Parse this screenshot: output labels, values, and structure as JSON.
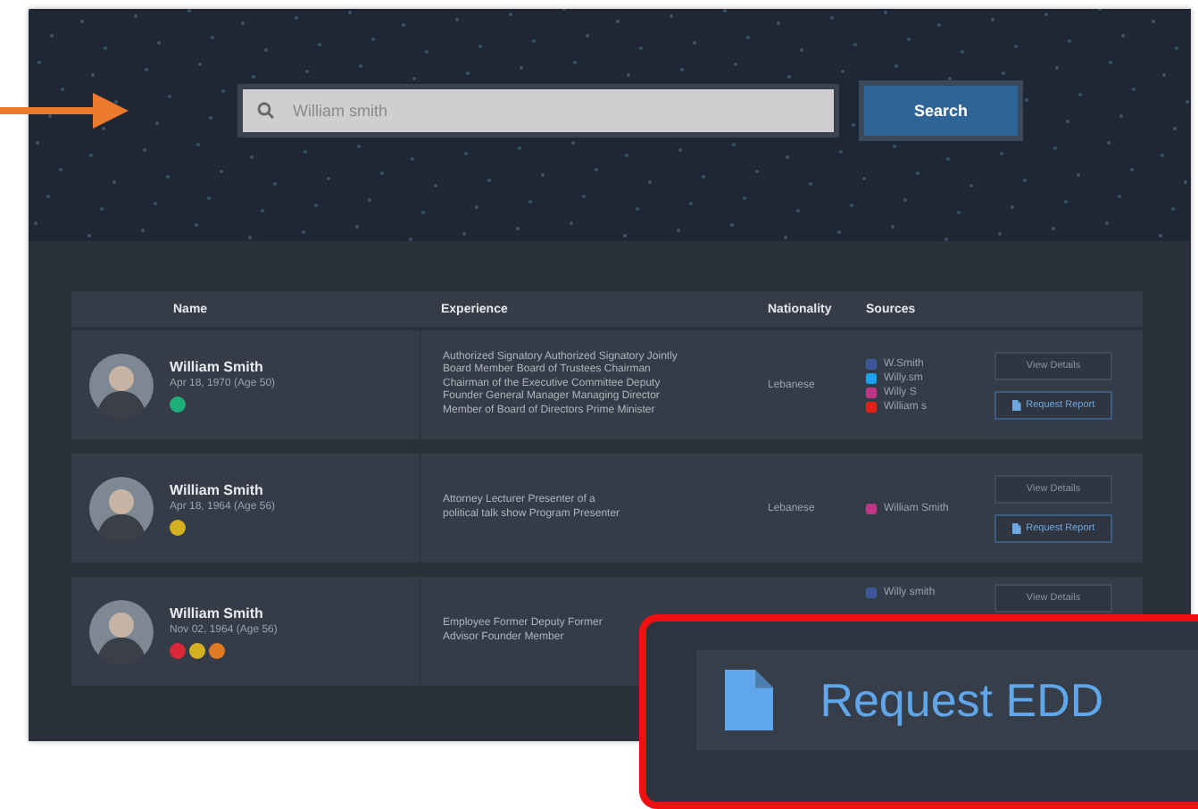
{
  "search": {
    "placeholder": "William smith",
    "button": "Search"
  },
  "table": {
    "columns": [
      "Name",
      "Experience",
      "Nationality",
      "Sources"
    ],
    "rows": [
      {
        "name": "William Smith",
        "born": "Apr 18, 1970 (Age 50)",
        "badges": [
          {
            "color": "#1fae7a"
          }
        ],
        "experience": "Authorized Signatory Authorized Signatory Jointly\nBoard Member Board of Trustees Chairman\nChairman of the Executive Committee Deputy\nFounder General Manager Managing Director\nMember of Board of Directors Prime Minister",
        "nationality": "Lebanese",
        "sources": [
          {
            "kind": "facebook",
            "handle": "W.Smith"
          },
          {
            "kind": "twitter",
            "handle": "Willy.sm"
          },
          {
            "kind": "instagram",
            "handle": "Willy S"
          },
          {
            "kind": "youtube",
            "handle": "William s"
          }
        ],
        "actions": [
          "View Details",
          "Request Report"
        ]
      },
      {
        "name": "William Smith",
        "born": "Apr 18, 1964 (Age 56)",
        "badges": [
          {
            "color": "#d4b020"
          }
        ],
        "experience": "Attorney Lecturer Presenter of a\npolitical talk show Program Presenter",
        "nationality": "Lebanese",
        "sources": [
          {
            "kind": "instagram",
            "handle": "William Smith"
          }
        ],
        "actions": [
          "View Details",
          "Request Report"
        ]
      },
      {
        "name": "William Smith",
        "born": "Nov 02, 1964 (Age 56)",
        "badges": [
          {
            "color": "#d8283a"
          },
          {
            "color": "#d4b020"
          },
          {
            "color": "#e07a22"
          }
        ],
        "experience": "Employee Former Deputy Former\nAdvisor Founder Member",
        "sources": [
          {
            "kind": "facebook",
            "handle": "Willy smith"
          }
        ],
        "actions": [
          "View Details"
        ]
      }
    ]
  },
  "callout": {
    "label": "Request EDD"
  }
}
